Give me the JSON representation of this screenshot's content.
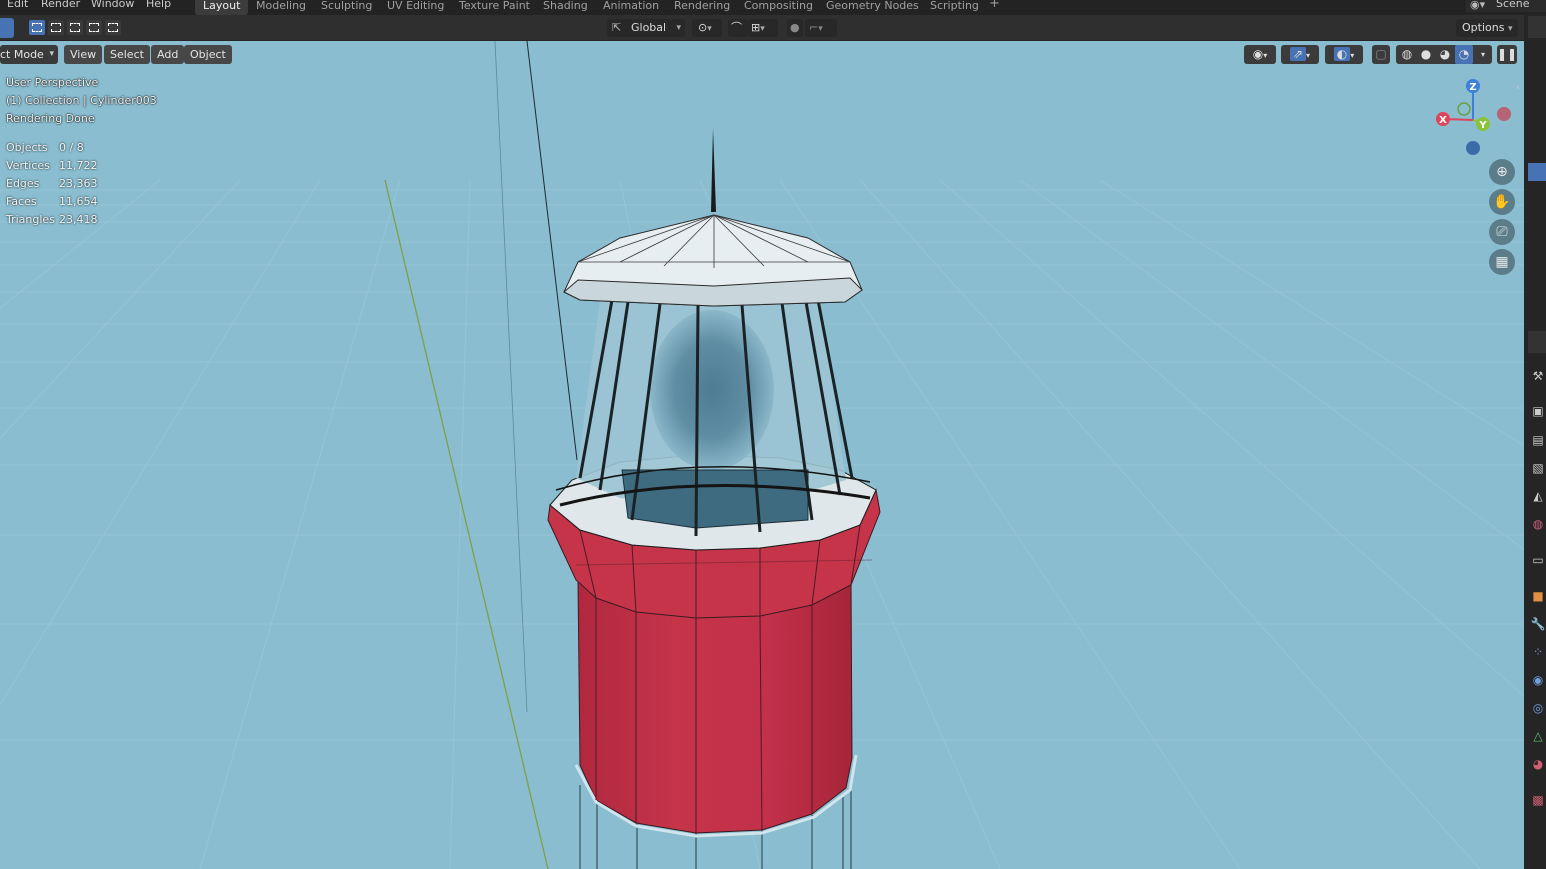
{
  "menus": [
    "Edit",
    "Render",
    "Window",
    "Help"
  ],
  "workspaces": [
    "Layout",
    "Modeling",
    "Sculpting",
    "UV Editing",
    "Texture Paint",
    "Shading",
    "Animation",
    "Rendering",
    "Compositing",
    "Geometry Nodes",
    "Scripting"
  ],
  "active_workspace": "Layout",
  "add_workspace_icon": "plus-icon",
  "scene_name": "Scene",
  "header": {
    "transform_orientation": "Global",
    "options_label": "Options"
  },
  "viewport_menu": {
    "mode": "ct Mode",
    "view": "View",
    "select": "Select",
    "add": "Add",
    "object": "Object"
  },
  "overlay_info": {
    "perspective": "User Perspective",
    "collection": "(1) Collection | Cylinder003",
    "status": "Rendering Done"
  },
  "stats": [
    {
      "label": "Objects",
      "value": "0 / 8"
    },
    {
      "label": "Vertices",
      "value": "11,722"
    },
    {
      "label": "Edges",
      "value": "23,363"
    },
    {
      "label": "Faces",
      "value": "11,654"
    },
    {
      "label": "Triangles",
      "value": "23,418"
    }
  ],
  "gizmo": {
    "z": "Z",
    "x": "X",
    "y": "Y"
  },
  "nav_icons": [
    "zoom-icon",
    "hand-pan-icon",
    "camera-icon",
    "grid-perspective-icon"
  ],
  "colors": {
    "viewport_bg": "#89bdcf",
    "lighthouse_red": "#c2304a",
    "axis_x": "#e0445a",
    "axis_y": "#8ac33a",
    "axis_z": "#3d7fd9",
    "active_blue": "#4772b3"
  }
}
